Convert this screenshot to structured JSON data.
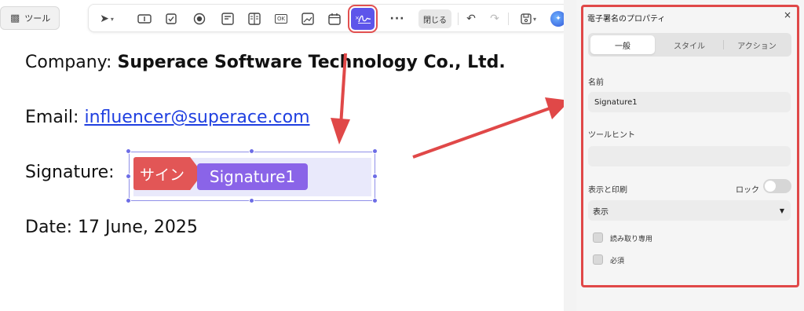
{
  "toolbar": {
    "tools_label": "ツール",
    "close_label": "閉じる",
    "buttons": [
      {
        "name": "select-tool",
        "icon": "cursor-arrow-icon"
      },
      {
        "name": "text-field-tool",
        "icon": "text-field-icon"
      },
      {
        "name": "checkbox-tool",
        "icon": "checkbox-icon"
      },
      {
        "name": "radio-tool",
        "icon": "radio-button-icon"
      },
      {
        "name": "combo-box-tool",
        "icon": "combo-box-icon"
      },
      {
        "name": "list-box-tool",
        "icon": "list-box-icon"
      },
      {
        "name": "button-tool",
        "icon": "ok-button-icon"
      },
      {
        "name": "image-field-tool",
        "icon": "image-field-icon"
      },
      {
        "name": "date-field-tool",
        "icon": "calendar-icon"
      },
      {
        "name": "signature-field-tool",
        "icon": "signature-icon"
      },
      {
        "name": "more-tool",
        "icon": "ellipsis-icon"
      },
      {
        "name": "undo",
        "icon": "undo-icon"
      },
      {
        "name": "redo",
        "icon": "redo-icon"
      },
      {
        "name": "save",
        "icon": "save-icon"
      },
      {
        "name": "ai-assistant",
        "icon": "ai-avatar-icon"
      }
    ],
    "ok_glyph": "OK"
  },
  "document": {
    "company_label": "Company: ",
    "company_value": "Superace Software Technology Co., Ltd.",
    "email_label": "Email: ",
    "email_value": "influencer@superace.com",
    "signature_label": "Signature:",
    "date_line": "Date: 17 June, 2025",
    "sign_tag": "サイン",
    "signature_field_name": "Signature1"
  },
  "panel": {
    "title": "電子署名のプロパティ",
    "close_glyph": "×",
    "tabs": [
      "一般",
      "スタイル",
      "アクション"
    ],
    "active_tab": "一般",
    "name_label": "名前",
    "name_value": "Signature1",
    "tooltip_label": "ツールヒント",
    "tooltip_value": "",
    "display_print_label": "表示と印刷",
    "lock_label": "ロック",
    "lock_on": false,
    "visibility_value": "表示",
    "readonly_label": "読み取り専用",
    "required_label": "必須",
    "readonly_checked": false,
    "required_checked": false
  },
  "colors": {
    "accent": "#5d55ea",
    "highlight_red": "#e04848",
    "sign_tag": "#e25656",
    "signature_label_bg": "#8a64e8",
    "link": "#1f3fe0"
  }
}
